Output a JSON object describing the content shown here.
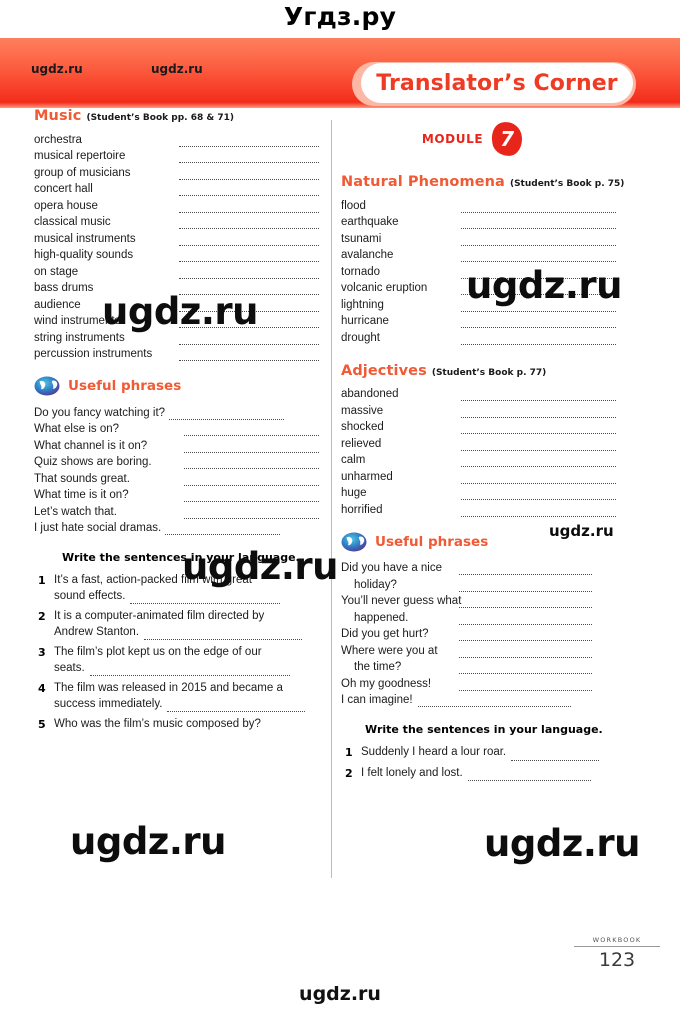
{
  "site": {
    "title_top": "Угдз.ру",
    "title_bottom": "ugdz.ru",
    "header_watermark_a": "ugdz.ru",
    "header_watermark_b": "ugdz.ru",
    "watermarks": [
      "ugdz.ru",
      "ugdz.ru",
      "ugdz.ru",
      "ugdz.ru",
      "ugdz.ru",
      "ugdz.ru",
      "ugdz.ru"
    ]
  },
  "banner": {
    "label": "Translator’s Corner",
    "text_color": "#ef3b24",
    "pill_color": "#ffffff",
    "glow_color": "#fcb8a4"
  },
  "module": {
    "word": "MODULE",
    "number": "7",
    "color": "#e8251a"
  },
  "left": {
    "music": {
      "title": "Music",
      "reference": "(Student’s Book pp. 68 & 71)",
      "words": [
        "orchestra",
        "musical repertoire",
        "group of musicians",
        "concert hall",
        "opera house",
        "classical music",
        "musical instruments",
        "high-quality sounds",
        "on stage",
        "bass drums",
        "audience",
        "wind instruments",
        "string instruments",
        "percussion instruments"
      ]
    },
    "useful_phrases": {
      "title": "Useful phrases",
      "icon": "speech-bubbles-icon",
      "phrases": [
        {
          "text": "Do you fancy watching it?",
          "wide": true
        },
        {
          "text": "What else is on?",
          "wide": false
        },
        {
          "text": "What channel is it on?",
          "wide": false
        },
        {
          "text": "Quiz shows are boring.",
          "wide": false
        },
        {
          "text": "That sounds great.",
          "wide": false
        },
        {
          "text": "What time is it on?",
          "wide": false
        },
        {
          "text": "Let’s watch that.",
          "wide": false
        },
        {
          "text": "I just hate social dramas.",
          "wide": true
        }
      ]
    },
    "write_instruction": "Write the sentences in your language.",
    "exercise": [
      {
        "num": "1",
        "line1": "It’s a fast, action-packed film with great",
        "line2": "sound effects."
      },
      {
        "num": "2",
        "line1": "It is a computer-animated film directed by",
        "line2": "Andrew Stanton."
      },
      {
        "num": "3",
        "line1": "The film’s plot kept us on the edge of our",
        "line2": "seats."
      },
      {
        "num": "4",
        "line1": "The film was released in 2015 and became a",
        "line2": "success immediately."
      },
      {
        "num": "5",
        "line1": "Who was the film’s music composed by?",
        "line2": ""
      }
    ]
  },
  "right": {
    "natural_phenomena": {
      "title": "Natural Phenomena",
      "reference": "(Student’s Book p. 75)",
      "words": [
        "flood",
        "earthquake",
        "tsunami",
        "avalanche",
        "tornado",
        "volcanic eruption",
        "lightning",
        "hurricane",
        "drought"
      ]
    },
    "adjectives": {
      "title": "Adjectives",
      "reference": "(Student’s Book p. 77)",
      "words": [
        "abandoned",
        "massive",
        "shocked",
        "relieved",
        "calm",
        "unharmed",
        "huge",
        "horrified"
      ]
    },
    "useful_phrases": {
      "title": "Useful phrases",
      "icon": "speech-bubbles-icon",
      "phrases": [
        {
          "text": "Did you have a nice",
          "style": "normal"
        },
        {
          "text": "holiday?",
          "style": "indent"
        },
        {
          "text": "You’ll never guess what",
          "style": "normal"
        },
        {
          "text": "happened.",
          "style": "indent"
        },
        {
          "text": "Did you get hurt?",
          "style": "normal"
        },
        {
          "text": "Where were you at",
          "style": "normal"
        },
        {
          "text": "the time?",
          "style": "indent"
        },
        {
          "text": "Oh my goodness!",
          "style": "normal"
        },
        {
          "text": "I can imagine!",
          "style": "full"
        }
      ]
    },
    "write_instruction": "Write the sentences in your language.",
    "exercise": [
      {
        "num": "1",
        "line1": "Suddenly I heard a lour roar.",
        "line2": ""
      },
      {
        "num": "2",
        "line1": "I felt lonely and lost.",
        "line2": ""
      }
    ]
  },
  "footer": {
    "label": "WORKBOOK",
    "page": "123"
  }
}
